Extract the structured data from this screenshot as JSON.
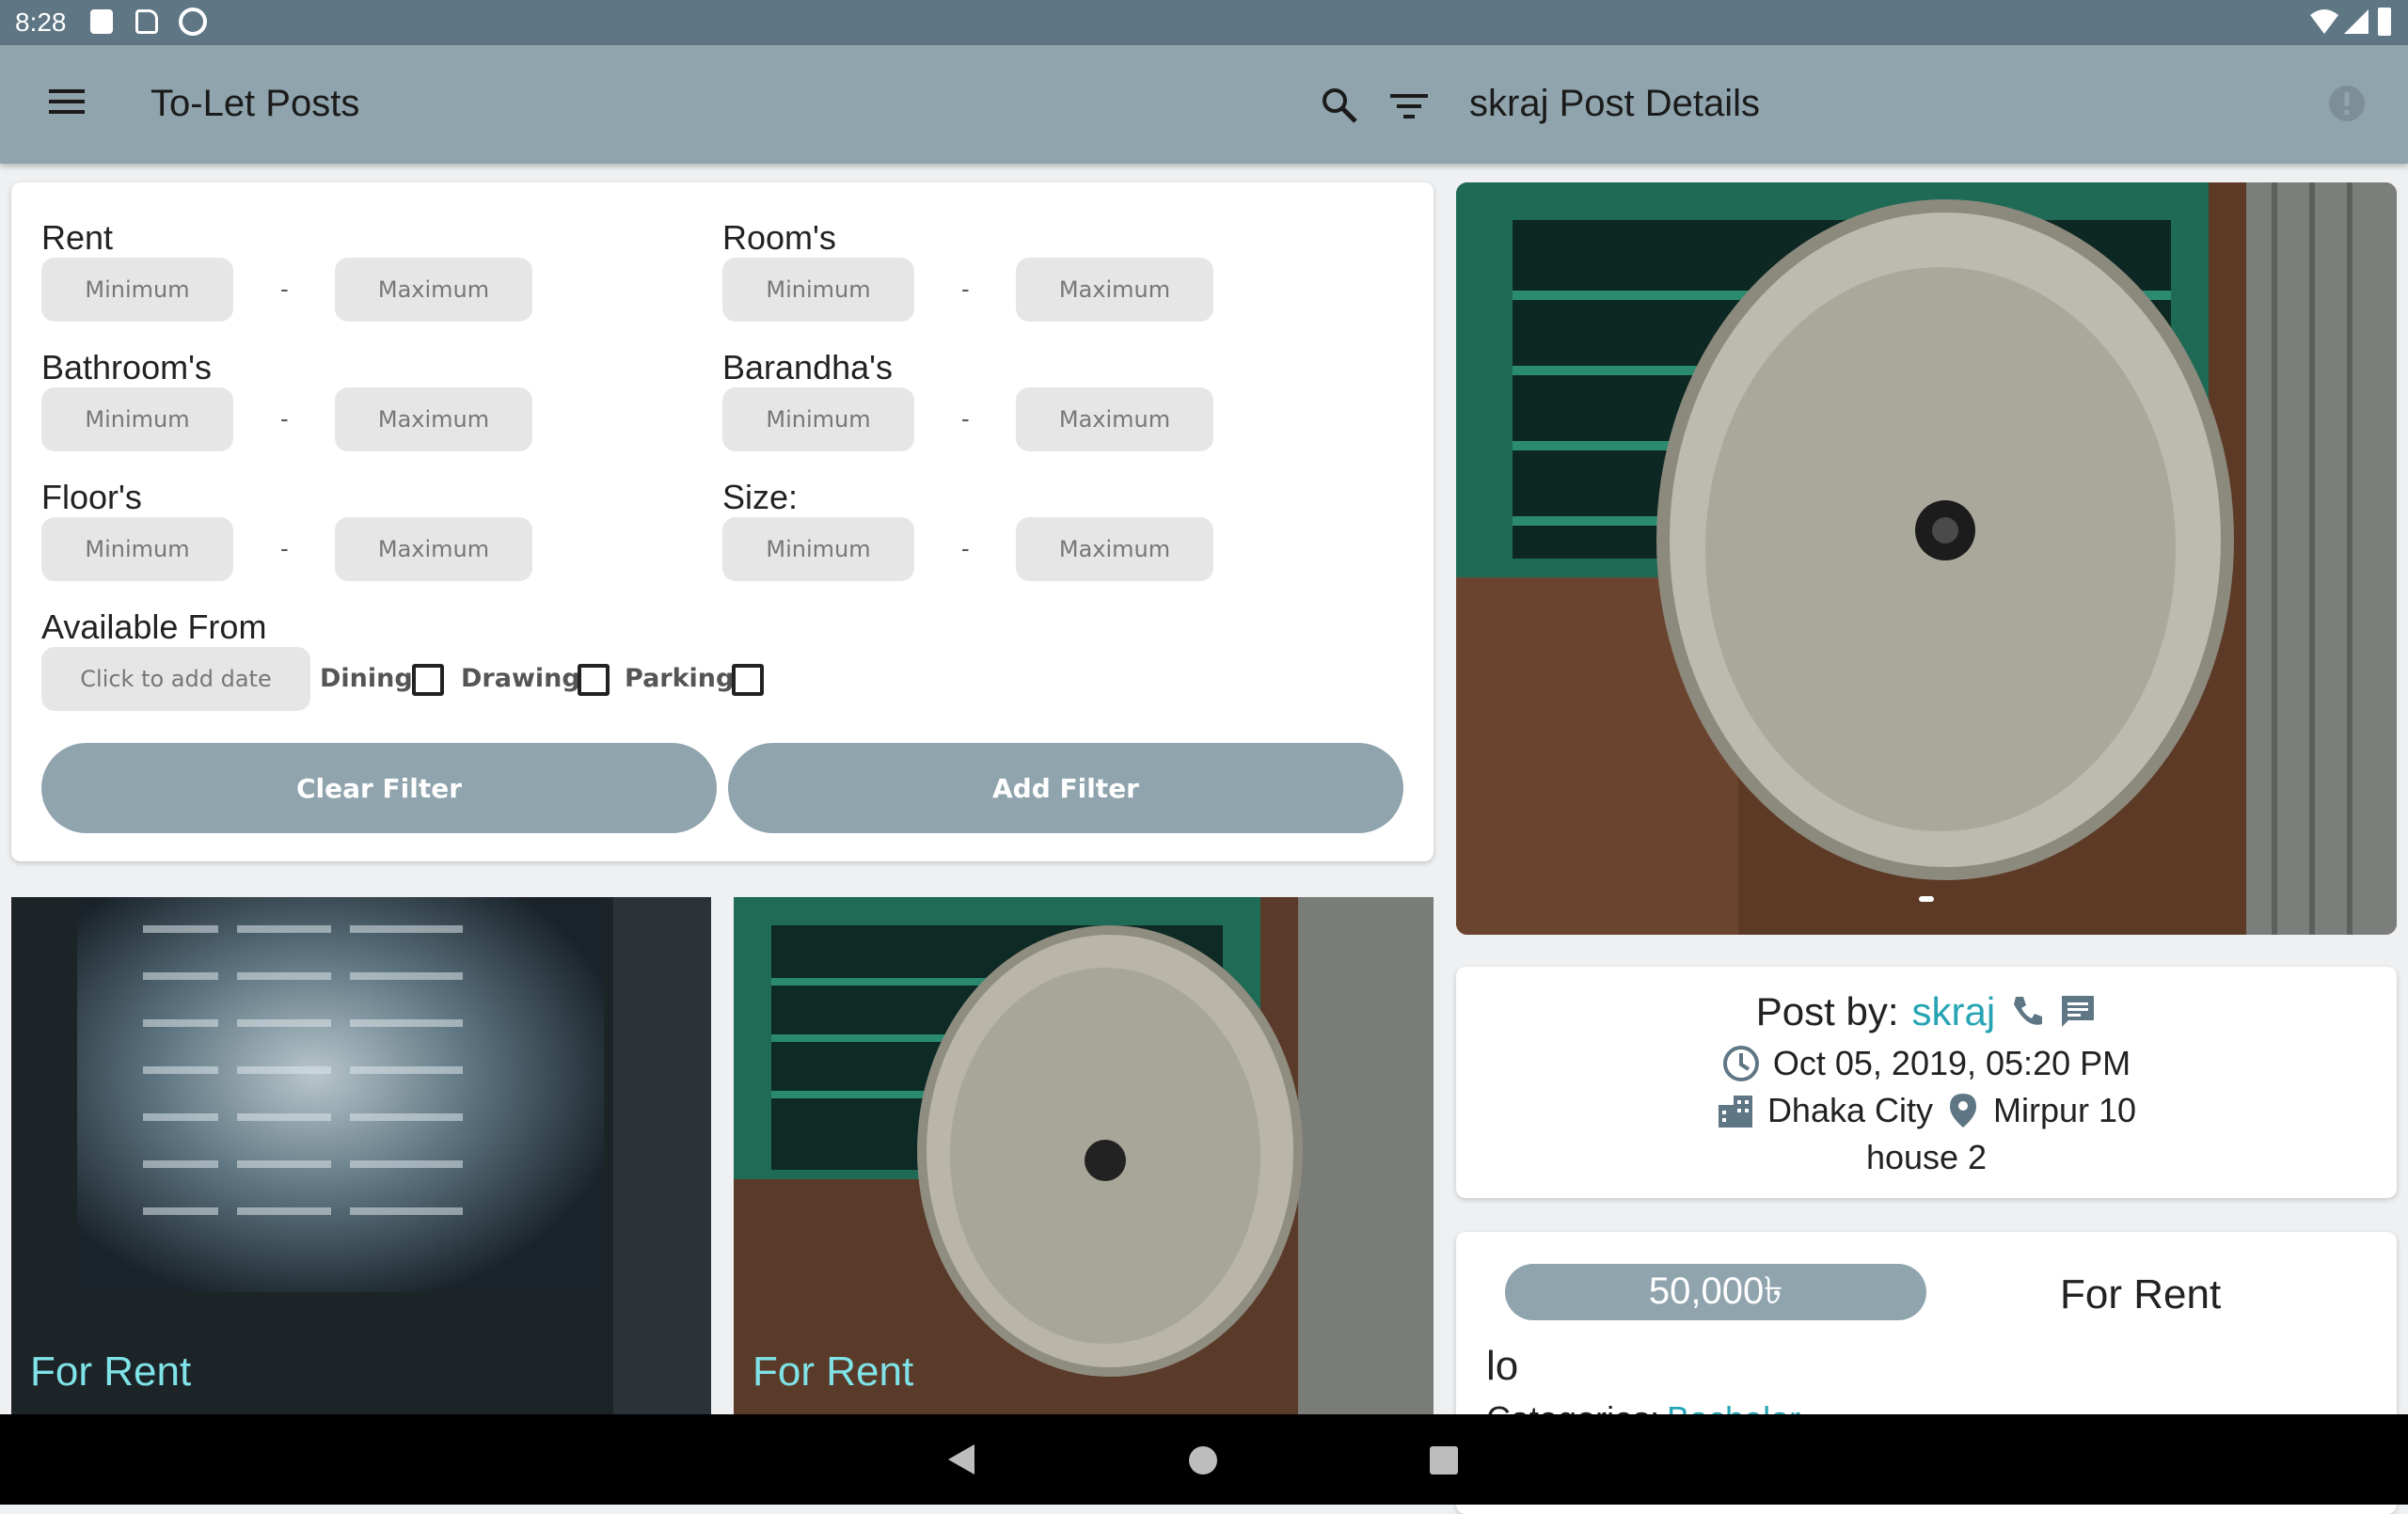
{
  "status_bar": {
    "time": "8:28"
  },
  "app_bar": {
    "left_title": "To-Let Posts",
    "right_title": "skraj Post Details"
  },
  "filter": {
    "rent_label": "Rent",
    "rooms_label": "Room's",
    "bathrooms_label": "Bathroom's",
    "barandhas_label": "Barandha's",
    "floors_label": "Floor's",
    "size_label": "Size:",
    "available_label": "Available From",
    "min_placeholder": "Minimum",
    "max_placeholder": "Maximum",
    "dash": "-",
    "date_placeholder": "Click to add date",
    "dining_label": "Dining",
    "drawing_label": "Drawing",
    "parking_label": "Parking",
    "clear_label": "Clear Filter",
    "add_label": "Add Filter"
  },
  "posts": [
    {
      "tag": "For Rent"
    },
    {
      "tag": "For Rent"
    }
  ],
  "details": {
    "post_by_label": "Post by:",
    "author": "skraj",
    "datetime": "Oct 05, 2019, 05:20 PM",
    "city": "Dhaka City",
    "area": "Mirpur 10",
    "address": "house 2",
    "price": "50,000৳",
    "type": "For Rent",
    "title": "lo",
    "categories_label": "Categories:",
    "category": "Bachelor"
  },
  "colors": {
    "accent": "#90a4ae",
    "link": "#26a4b4",
    "status": "#5f7684"
  }
}
